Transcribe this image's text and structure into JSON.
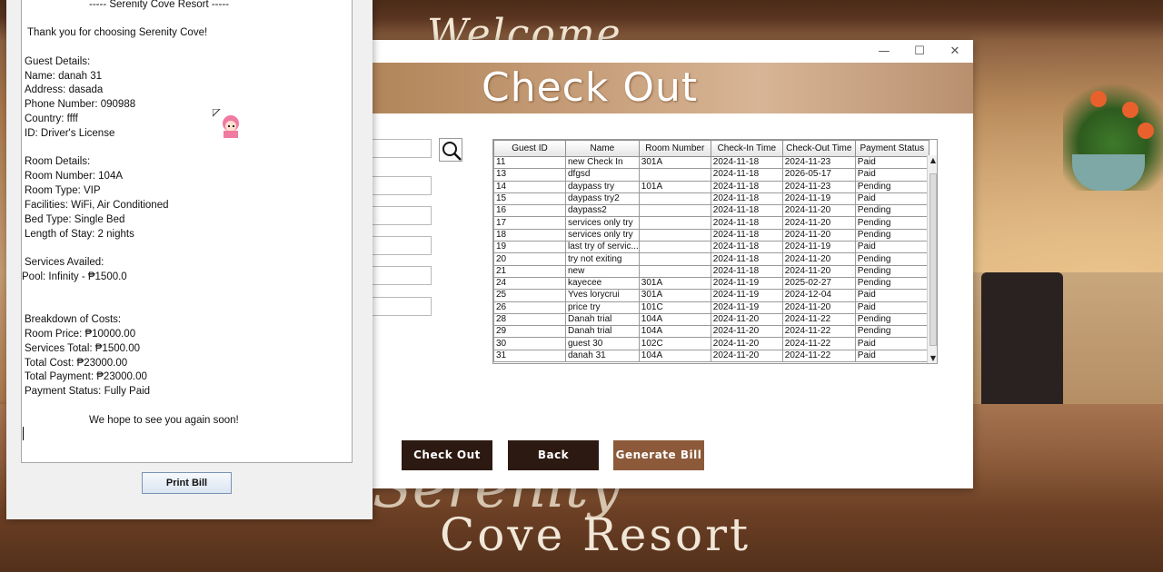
{
  "background": {
    "brand_top": "Welcome",
    "brand_bottom_line1": "Serenity",
    "brand_bottom_line2": "Cove Resort"
  },
  "checkout_window": {
    "title": "Check Out",
    "controls": {
      "minimize": "—",
      "maximize": "☐",
      "close": "✕"
    },
    "buttons": {
      "check_out": "Check Out",
      "back": "Back",
      "generate_bill": "Generate Bill"
    },
    "colors": {
      "dark_button": "#2c1a12",
      "generate_button": "#8c5a3a",
      "banner": "#c8a07c"
    },
    "table": {
      "headers": [
        "Guest ID",
        "Name",
        "Room Number",
        "Check-In Time",
        "Check-Out Time",
        "Payment Status"
      ],
      "rows": [
        [
          "11",
          "new Check In",
          "301A",
          "2024-11-18",
          "2024-11-23",
          "Paid"
        ],
        [
          "13",
          "dfgsd",
          "",
          "2024-11-18",
          "2026-05-17",
          "Paid"
        ],
        [
          "14",
          "daypass try",
          "101A",
          "2024-11-18",
          "2024-11-23",
          "Pending"
        ],
        [
          "15",
          "daypass try2",
          "",
          "2024-11-18",
          "2024-11-19",
          "Paid"
        ],
        [
          "16",
          "daypass2",
          "",
          "2024-11-18",
          "2024-11-20",
          "Pending"
        ],
        [
          "17",
          "services only try",
          "",
          "2024-11-18",
          "2024-11-20",
          "Pending"
        ],
        [
          "18",
          "services only try",
          "",
          "2024-11-18",
          "2024-11-20",
          "Pending"
        ],
        [
          "19",
          "last try of servic...",
          "",
          "2024-11-18",
          "2024-11-19",
          "Paid"
        ],
        [
          "20",
          "try not exiting",
          "",
          "2024-11-18",
          "2024-11-20",
          "Pending"
        ],
        [
          "21",
          "new",
          "",
          "2024-11-18",
          "2024-11-20",
          "Pending"
        ],
        [
          "24",
          "kayecee",
          "301A",
          "2024-11-19",
          "2025-02-27",
          "Pending"
        ],
        [
          "25",
          "Yves lorycrui",
          "301A",
          "2024-11-19",
          "2024-12-04",
          "Paid"
        ],
        [
          "26",
          "price try",
          "101C",
          "2024-11-19",
          "2024-11-20",
          "Paid"
        ],
        [
          "28",
          "Danah trial",
          "104A",
          "2024-11-20",
          "2024-11-22",
          "Pending"
        ],
        [
          "29",
          "Danah trial",
          "104A",
          "2024-11-20",
          "2024-11-22",
          "Pending"
        ],
        [
          "30",
          "guest 30",
          "102C",
          "2024-11-20",
          "2024-11-22",
          "Paid"
        ],
        [
          "31",
          "danah 31",
          "104A",
          "2024-11-20",
          "2024-11-22",
          "Paid"
        ]
      ]
    }
  },
  "receipt_window": {
    "lines": [
      "----- Serenity Cove Resort -----",
      "Thank you for choosing Serenity Cove!",
      "Guest Details:",
      "Name: danah 31",
      "Address: dasada",
      "Phone Number: 090988",
      "Country: ffff",
      "ID: Driver's License",
      "Room Details:",
      "Room Number: 104A",
      "Room Type: VIP",
      "Facilities: WiFi, Air Conditioned",
      "Bed Type: Single Bed",
      "Length of Stay: 2 nights",
      "Services Availed:",
      "Pool: Infinity - ₱1500.0",
      "Breakdown of Costs:",
      "Room Price: ₱10000.00",
      "Services Total: ₱1500.00",
      "Total Cost: ₱23000.00",
      "Total Payment: ₱23000.00",
      "Payment Status: Fully Paid",
      "We hope to see you again soon!"
    ],
    "print_button": "Print Bill"
  }
}
